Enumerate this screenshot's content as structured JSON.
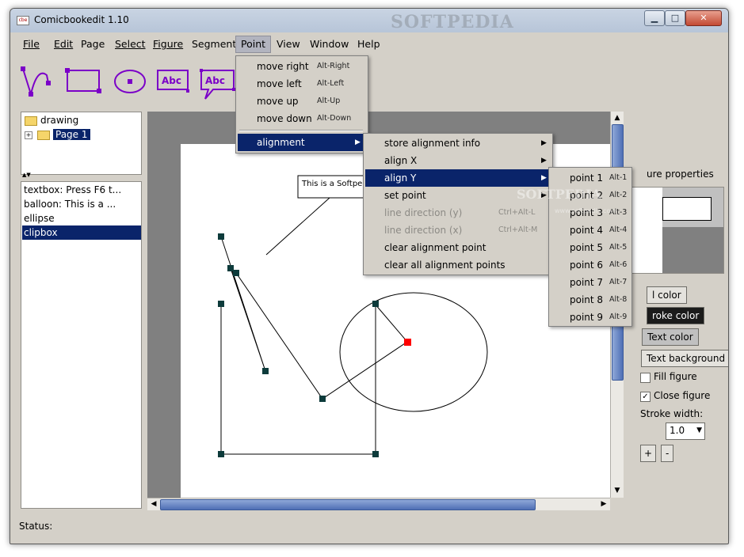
{
  "window": {
    "title": "Comicbookedit 1.10",
    "watermark": "SOFTPEDIA",
    "caption_buttons": {
      "minimize": "▁",
      "maximize": "□",
      "close": "✕"
    }
  },
  "menubar": {
    "items": [
      "File",
      "Edit",
      "Page",
      "Select",
      "Figure",
      "Segment",
      "Point",
      "View",
      "Window",
      "Help"
    ],
    "active": "Point"
  },
  "toolbar": {
    "tools": [
      "bezier-tool",
      "rectangle-tool",
      "ellipse-tool",
      "textbox-tool",
      "balloon-tool"
    ],
    "textbox_label": "Abc",
    "balloon_label": "Abc"
  },
  "tree": {
    "root": "drawing",
    "child": "Page 1",
    "expander": "+"
  },
  "splitter_arrows": "▲▼",
  "figure_list": {
    "items": [
      "textbox: Press F6 t...",
      "balloon: This is a ...",
      "ellipse",
      "clipbox"
    ],
    "selected_index": 3
  },
  "canvas": {
    "balloon_text": "This is a Softped",
    "accent_color": "#7b00c8",
    "point_color": "#0d3b3b",
    "selected_point_color": "#ff0000"
  },
  "scrollbars": {
    "up": "▲",
    "down": "▼",
    "left": "◀",
    "right": "▶"
  },
  "point_menu": {
    "items": [
      {
        "label": "move right",
        "accel": "Alt-Right"
      },
      {
        "label": "move left",
        "accel": "Alt-Left"
      },
      {
        "label": "move up",
        "accel": "Alt-Up"
      },
      {
        "label": "move down",
        "accel": "Alt-Down"
      }
    ],
    "alignment": {
      "label": "alignment",
      "arrow": "▶"
    }
  },
  "alignment_menu": {
    "items": [
      {
        "label": "store alignment info",
        "accel": "",
        "arrow": "▶",
        "enabled": true
      },
      {
        "label": "align X",
        "accel": "",
        "arrow": "▶",
        "enabled": true
      },
      {
        "label": "align Y",
        "accel": "",
        "arrow": "▶",
        "enabled": true,
        "highlighted": true
      },
      {
        "label": "set point",
        "accel": "",
        "arrow": "▶",
        "enabled": true
      },
      {
        "label": "line direction (y)",
        "accel": "Ctrl+Alt-L",
        "arrow": "",
        "enabled": false
      },
      {
        "label": "line direction (x)",
        "accel": "Ctrl+Alt-M",
        "arrow": "",
        "enabled": false
      },
      {
        "label": "clear alignment point",
        "accel": "",
        "arrow": "",
        "enabled": true
      },
      {
        "label": "clear all alignment points",
        "accel": "",
        "arrow": "",
        "enabled": true
      }
    ]
  },
  "aligny_menu": {
    "items": [
      {
        "label": "point 1",
        "accel": "Alt-1"
      },
      {
        "label": "point 2",
        "accel": "Alt-2"
      },
      {
        "label": "point 3",
        "accel": "Alt-3"
      },
      {
        "label": "point 4",
        "accel": "Alt-4"
      },
      {
        "label": "point 5",
        "accel": "Alt-5"
      },
      {
        "label": "point 6",
        "accel": "Alt-6"
      },
      {
        "label": "point 7",
        "accel": "Alt-7"
      },
      {
        "label": "point 8",
        "accel": "Alt-8"
      },
      {
        "label": "point 9",
        "accel": "Alt-9"
      }
    ]
  },
  "properties": {
    "title": "ure properties",
    "fill_color": "l color",
    "stroke_color": "roke color",
    "text_color": "Text color",
    "text_background": "Text background",
    "fill_figure": {
      "label": "Fill figure",
      "checked": false
    },
    "close_figure": {
      "label": "Close figure",
      "checked": true,
      "mark": "✓"
    },
    "stroke_width_label": "Stroke width:",
    "stroke_width_value": "1.0",
    "stroke_width_arrow": "▼",
    "plus": "+",
    "minus": "-"
  },
  "status": {
    "text": "Status:"
  },
  "softpedia_overlay": "SOFTPEDIA",
  "softpedia_overlay_small": "www.softpedia.com"
}
